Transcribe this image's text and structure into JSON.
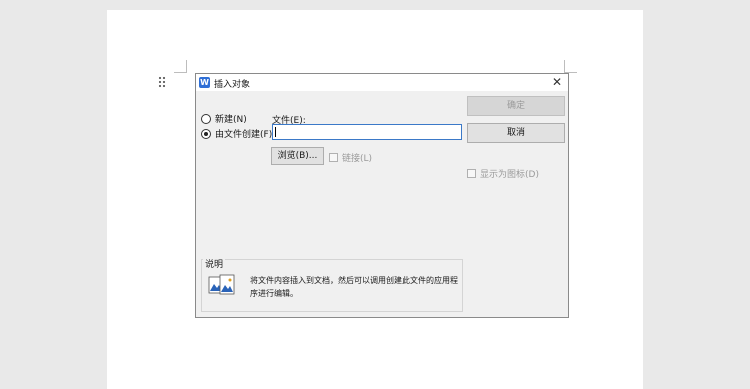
{
  "dialog": {
    "app_icon_letter": "W",
    "title": "插入对象",
    "close_glyph": "✕",
    "options": [
      {
        "label": "新建(N)",
        "selected": false
      },
      {
        "label": "由文件创建(F)",
        "selected": true
      }
    ],
    "file_label": "文件(E):",
    "file_value": "",
    "browse_label": "浏览(B)...",
    "link_label": "链接(L)",
    "ok_label": "确定",
    "cancel_label": "取消",
    "show_icon_label": "显示为图标(D)",
    "description_title": "说明",
    "description_text": "将文件内容插入到文档，然后可以调用创建此文件的应用程序进行编辑。"
  },
  "icons": {
    "app": "wps-writer-icon",
    "close": "close-icon",
    "description": "document-pictures-icon"
  },
  "colors": {
    "accent": "#2f6fd6",
    "input_border": "#3b79c8"
  }
}
